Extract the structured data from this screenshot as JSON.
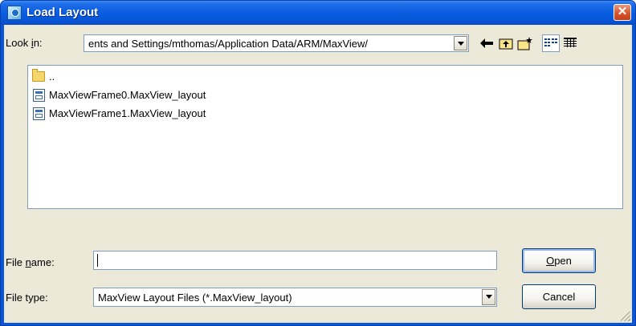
{
  "window": {
    "title": "Load Layout",
    "close_glyph": "✕"
  },
  "look_in": {
    "label_pre": "Look ",
    "label_key": "i",
    "label_post": "n:",
    "value": "ents and Settings/mthomas/Application Data/ARM/MaxView/"
  },
  "toolbar": {
    "back_icon": "arrow-left-icon",
    "up_icon": "up-folder-icon",
    "new_folder_icon": "new-folder-icon",
    "list_view_icon": "list-view-icon",
    "details_view_icon": "details-view-icon"
  },
  "file_list": {
    "items": [
      {
        "label": "..",
        "icon": "folder-icon"
      },
      {
        "label": "MaxViewFrame0.MaxView_layout",
        "icon": "layout-file-icon"
      },
      {
        "label": "MaxViewFrame1.MaxView_layout",
        "icon": "layout-file-icon"
      }
    ]
  },
  "file_name": {
    "label_pre": "File ",
    "label_key": "n",
    "label_post": "ame:",
    "value": ""
  },
  "file_type": {
    "label": "File type:",
    "value": "MaxView Layout Files (*.MaxView_layout)"
  },
  "buttons": {
    "open_key": "O",
    "open_rest": "pen",
    "cancel": "Cancel"
  },
  "colors": {
    "titlebar": "#0a5ee0",
    "dialog_bg": "#ece9d8",
    "close_button": "#d8542c"
  }
}
